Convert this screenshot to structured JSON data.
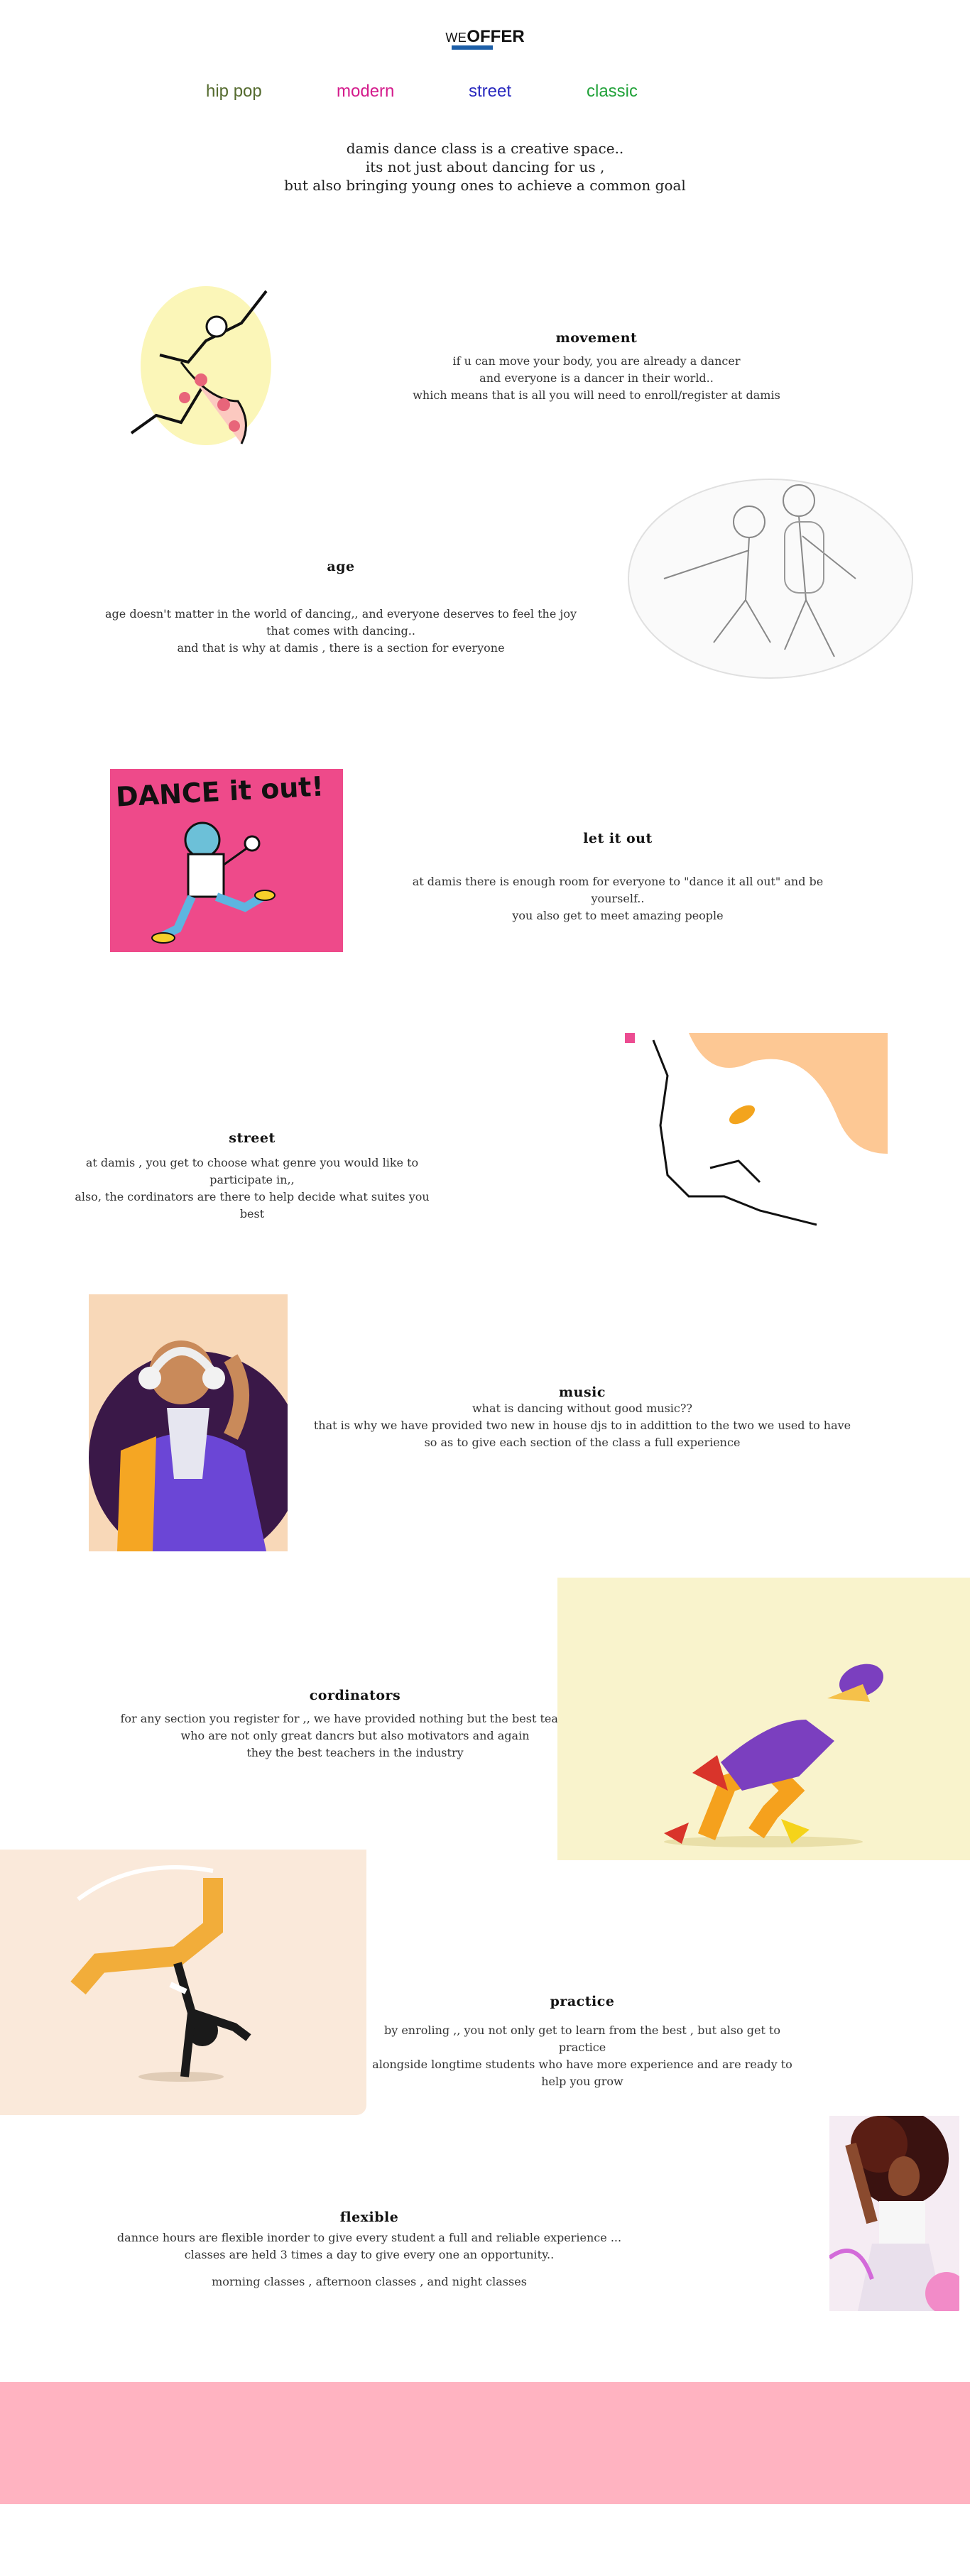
{
  "header": {
    "logo_we": "WE",
    "logo_offer": "OFFER"
  },
  "nav": [
    {
      "label": "hip pop",
      "color": "#556b2f"
    },
    {
      "label": "modern",
      "color": "#d41c8c"
    },
    {
      "label": "street",
      "color": "#2a2abf"
    },
    {
      "label": "classic",
      "color": "#22a23a"
    }
  ],
  "intro": {
    "line1": "damis dance class is a creative space..",
    "line2": "its not just about dancing for us ,",
    "line3": "but also bringing young ones to achieve a common goal"
  },
  "sections": {
    "movement": {
      "title": "movement",
      "l1": "if  u can move your body, you are already a dancer",
      "l2": "and everyone is a dancer in their world..",
      "l3": "which means that is all you will need to enroll/register at damis"
    },
    "age": {
      "title": "age",
      "l1": "age doesn't matter in the world of  dancing,, and everyone deserves to feel the joy",
      "l2": "that comes with dancing..",
      "l3": "and that is why at damis , there is a section for everyone"
    },
    "letitout": {
      "title": "let it out",
      "l1": "at damis there is enough room for everyone to \"dance it all out\" and be yourself..",
      "l2": "you also get to meet amazing people",
      "image_text": "DANCE it out!"
    },
    "street": {
      "title": "street",
      "l1": "at damis , you get to choose what genre you would like to  participate in,,",
      "l2": "also, the cordinators are there to help decide what suites you best"
    },
    "music": {
      "title": "music",
      "l1": "what is dancing without good music??",
      "l2": "that is why we have provided two new in house djs to in addittion to the two we used to have",
      "l3": "so as to give each section of  the class a full experience"
    },
    "cordinators": {
      "title": "cordinators",
      "l1": "for  any section you register for ,, we have provided nothing but the best teachers",
      "l2": "who are not  only great dancrs but also motivators and again",
      "l3": "they the best teachers in the industry"
    },
    "practice": {
      "title": "practice",
      "l1": "by enroling ,, you not only get to learn from the best , but also get to practice",
      "l2": "alongside longtime students who have more experience and are ready to help you grow"
    },
    "flexible": {
      "title": "flexible",
      "l1": "dannce hours are flexible inorder to give every student a full and reliable experience ...",
      "l2": "classes are held 3 times a day to give every one an opportunity..",
      "l3": "morning classes  , afternoon classes , and night classes"
    }
  },
  "colors": {
    "footer": "#ffb3c1",
    "accent_bar": "#1d5fa8"
  }
}
